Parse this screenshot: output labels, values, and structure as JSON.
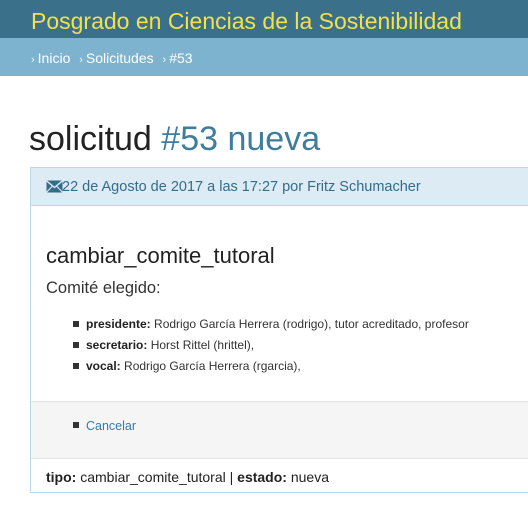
{
  "header": {
    "site_title": "Posgrado en Ciencias de la Sostenibilidad"
  },
  "breadcrumb": {
    "separator": "›",
    "items": [
      "Inicio",
      "Solicitudes",
      "#53"
    ]
  },
  "page": {
    "title_word": "solicitud",
    "title_number": "#53",
    "title_status": "nueva"
  },
  "panel": {
    "meta": "22 de Agosto de 2017 a las 17:27 por Fritz Schumacher",
    "request_type": "cambiar_comite_tutoral",
    "subtitle": "Comité elegido:",
    "members": [
      {
        "role": "presidente:",
        "detail": "Rodrigo García Herrera (rodrigo), tutor acreditado, profesor"
      },
      {
        "role": "secretario:",
        "detail": "Horst Rittel (hrittel),"
      },
      {
        "role": "vocal:",
        "detail": "Rodrigo García Herrera (rgarcia),"
      }
    ],
    "cancel_label": "Cancelar",
    "footer": {
      "tipo_label": "tipo:",
      "tipo_value": "cambiar_comite_tutoral",
      "divider": "|",
      "estado_label": "estado:",
      "estado_value": "nueva"
    }
  },
  "colors": {
    "topbar": "#3a7089",
    "crumbbar": "#7eb3cf",
    "title_yellow": "#f2e24a",
    "accent": "#3f7d9c"
  },
  "icons": {
    "meta": "envelope-icon",
    "bullet": "square-bullet-icon"
  }
}
